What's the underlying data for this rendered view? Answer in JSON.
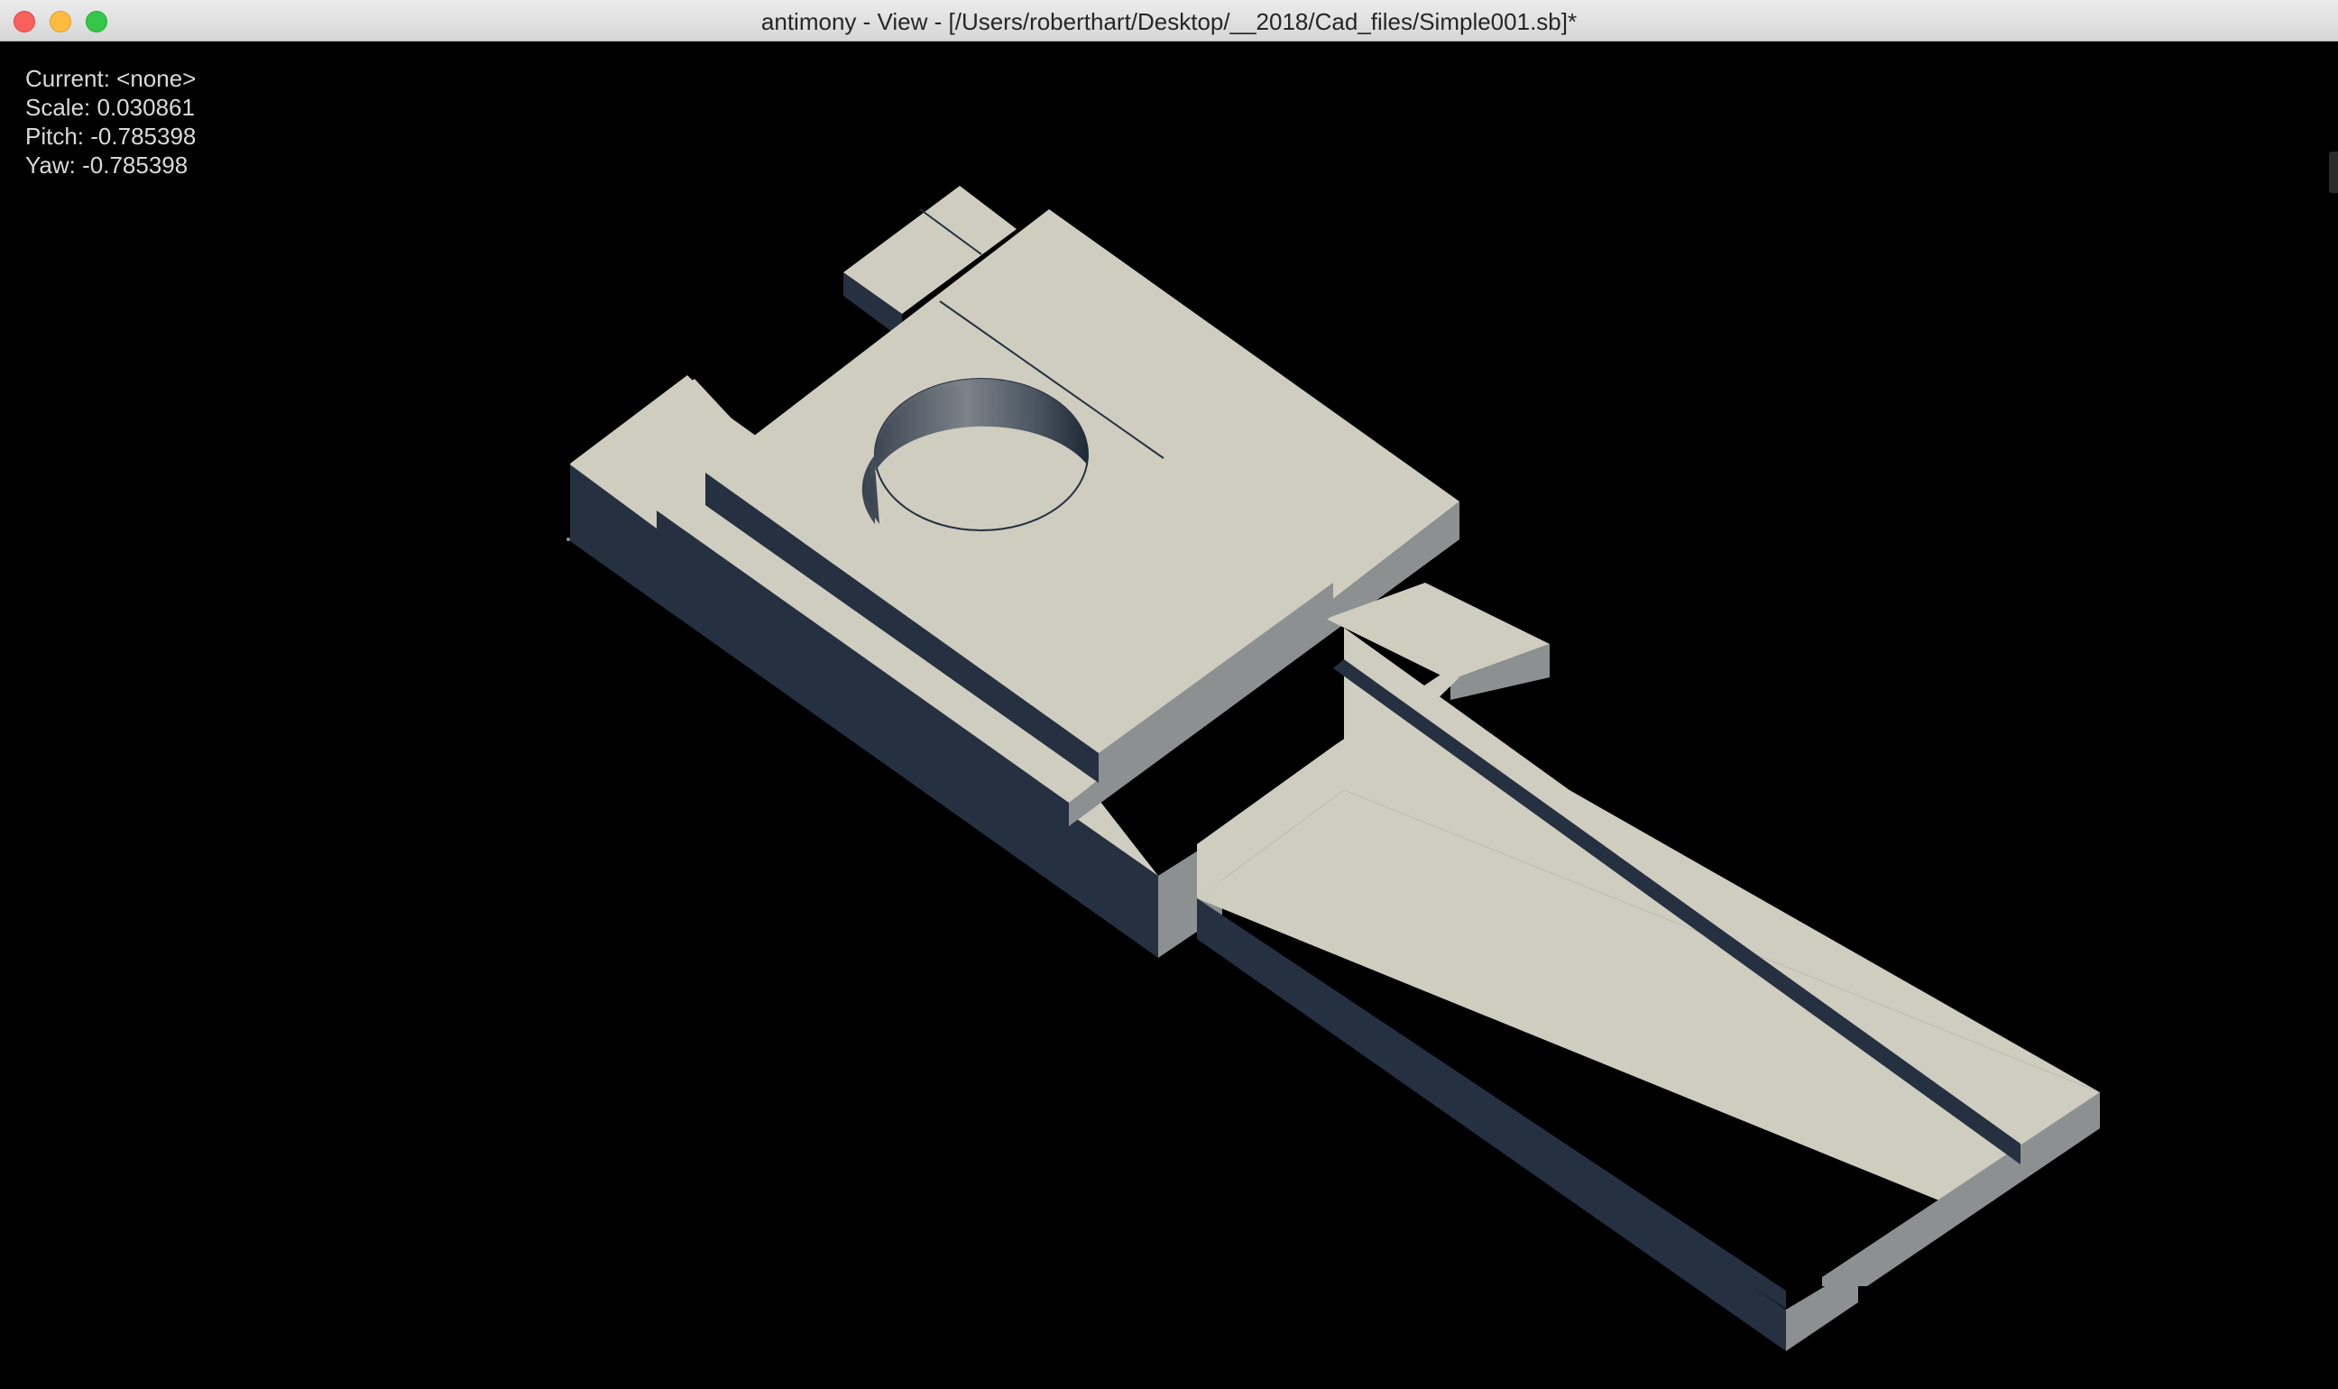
{
  "window": {
    "title": "antimony - View - [/Users/roberthart/Desktop/__2018/Cad_files/Simple001.sb]*"
  },
  "hud": {
    "current_label": "Current:",
    "current_value": "<none>",
    "scale_label": "Scale:",
    "scale_value": "0.030861",
    "pitch_label": "Pitch:",
    "pitch_value": "-0.785398",
    "yaw_label": "Yaw:",
    "yaw_value": "-0.785398"
  },
  "colors": {
    "background": "#000000",
    "top_face": "#cfcdc0",
    "left_face": "#253140",
    "right_face": "#8d9091",
    "titlebar": "#e3e3e3",
    "hud_text": "#d9d9d9"
  },
  "icons": {
    "close": "close-traffic-light-icon",
    "minimize": "minimize-traffic-light-icon",
    "zoom": "zoom-traffic-light-icon"
  }
}
